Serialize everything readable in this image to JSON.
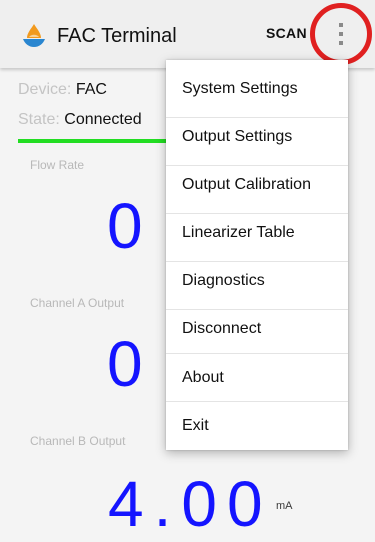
{
  "appbar": {
    "title": "FAC Terminal",
    "scan_label": "SCAN",
    "logo_icon": "flame-drop-logo-icon",
    "overflow_icon": "more-vertical-icon",
    "highlight_color": "#e02020"
  },
  "status": {
    "device_label": "Device:",
    "device_value": "FAC",
    "state_label": "State:",
    "state_value": "Connected",
    "state_color": "#22dd22"
  },
  "readings": [
    {
      "label": "Flow Rate",
      "value": "0",
      "unit": ""
    },
    {
      "label": "Channel A Output",
      "value": "0",
      "unit": ""
    },
    {
      "label": "Channel B Output",
      "value": "4.00",
      "unit": "mA"
    }
  ],
  "value_color": "#1414ff",
  "menu": {
    "items": [
      {
        "label": "System Settings"
      },
      {
        "label": "Output Settings"
      },
      {
        "label": "Output Calibration"
      },
      {
        "label": "Linearizer Table"
      },
      {
        "label": "Diagnostics"
      },
      {
        "label": "Disconnect"
      },
      {
        "label": "About"
      },
      {
        "label": "Exit"
      }
    ]
  }
}
